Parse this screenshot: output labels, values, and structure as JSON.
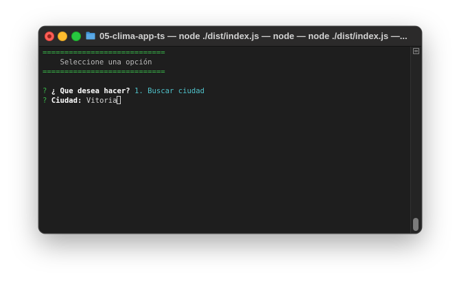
{
  "window": {
    "title": "05-clima-app-ts — node ./dist/index.js — node — node ./dist/index.js —..."
  },
  "terminal": {
    "separator_top": "============================",
    "menu_title": "    Seleccione una opción",
    "separator_bottom": "============================",
    "q1_mark": "?",
    "q1_label": "¿ Que desea hacer?",
    "q1_answer": "1. Buscar ciudad",
    "q2_mark": "?",
    "q2_label": "Ciudad:",
    "q2_input": "Vitoria"
  },
  "icons": {
    "folder": "folder-icon",
    "scroll": "scroll-marks-icon"
  },
  "colors": {
    "separator": "#39b54a",
    "accent_cyan": "#4fc1c9",
    "close": "#fe5f57",
    "minimize": "#febc2e",
    "maximize": "#28c840"
  }
}
